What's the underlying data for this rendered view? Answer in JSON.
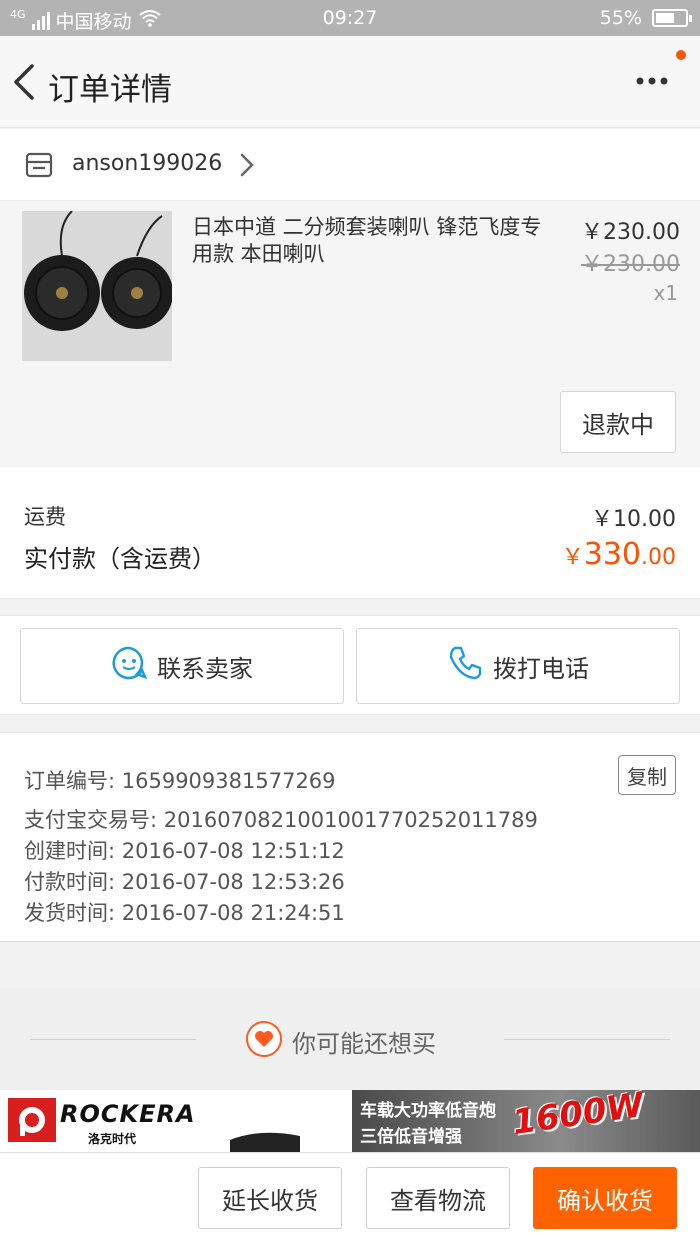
{
  "status_bar": {
    "network_type": "4G",
    "carrier": "中国移动",
    "time": "09:27",
    "battery": "55%",
    "battery_level": 0.55
  },
  "nav": {
    "title": "订单详情"
  },
  "shop": {
    "name": "anson199026"
  },
  "product": {
    "title": "日本中道 二分频套装喇叭 锋范飞度专用款 本田喇叭",
    "price": "￥230.00",
    "original_price": "￥230.00",
    "quantity": "x1",
    "status_button": "退款中"
  },
  "fees": {
    "shipping_label": "运费",
    "shipping_value": "￥10.00",
    "total_label": "实付款（含运费）",
    "total_currency": "￥",
    "total_integer": "330",
    "total_decimal": ".00",
    "accent_color": "#ff5000"
  },
  "contact": {
    "seller_label": "联系卖家",
    "phone_label": "拨打电话"
  },
  "order_info": {
    "order_no": "订单编号: 1659909381577269",
    "alipay_no": "支付宝交易号: 2016070821001001770252011789",
    "created": "创建时间: 2016-07-08 12:51:12",
    "paid": "付款时间: 2016-07-08 12:53:26",
    "shipped": "发货时间: 2016-07-08 21:24:51",
    "copy_label": "复制"
  },
  "recommend": {
    "title": "你可能还想买"
  },
  "ads": {
    "left_brand": "ROCKERA",
    "left_sub": "洛克时代",
    "right_line1": "车载大功率低音炮",
    "right_line2": "三倍低音增强",
    "right_big": "1600W"
  },
  "bottom_bar": {
    "extend_label": "延长收货",
    "logistics_label": "查看物流",
    "confirm_label": "确认收货",
    "primary_color": "#ff6200"
  }
}
